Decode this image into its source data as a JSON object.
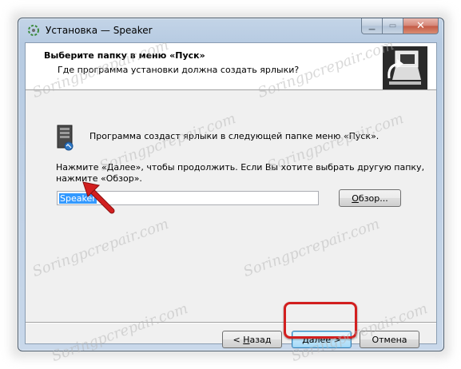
{
  "window": {
    "title": "Установка — Speaker",
    "minimize_glyph": "▁",
    "maximize_glyph": "▭",
    "close_glyph": "✕"
  },
  "header": {
    "title": "Выберите папку в меню «Пуск»",
    "subtitle": "Где программа установки должна создать ярлыки?"
  },
  "body": {
    "line1": "Программа создаст ярлыки в следующей папке меню «Пуск».",
    "line2": "Нажмите «Далее», чтобы продолжить. Если Вы хотите выбрать другую папку,",
    "line3": "нажмите «Обзор».",
    "folder_value": "Speaker"
  },
  "buttons": {
    "browse_mnemonic": "О",
    "browse_rest": "бзор...",
    "back_prefix": "< ",
    "back_mnemonic": "Н",
    "back_rest": "азад",
    "next": "Далее >",
    "cancel": "Отмена"
  },
  "watermark": "Soringpcrepair.com",
  "colors": {
    "accent_red": "#d21f1f",
    "selection": "#3399ff"
  }
}
